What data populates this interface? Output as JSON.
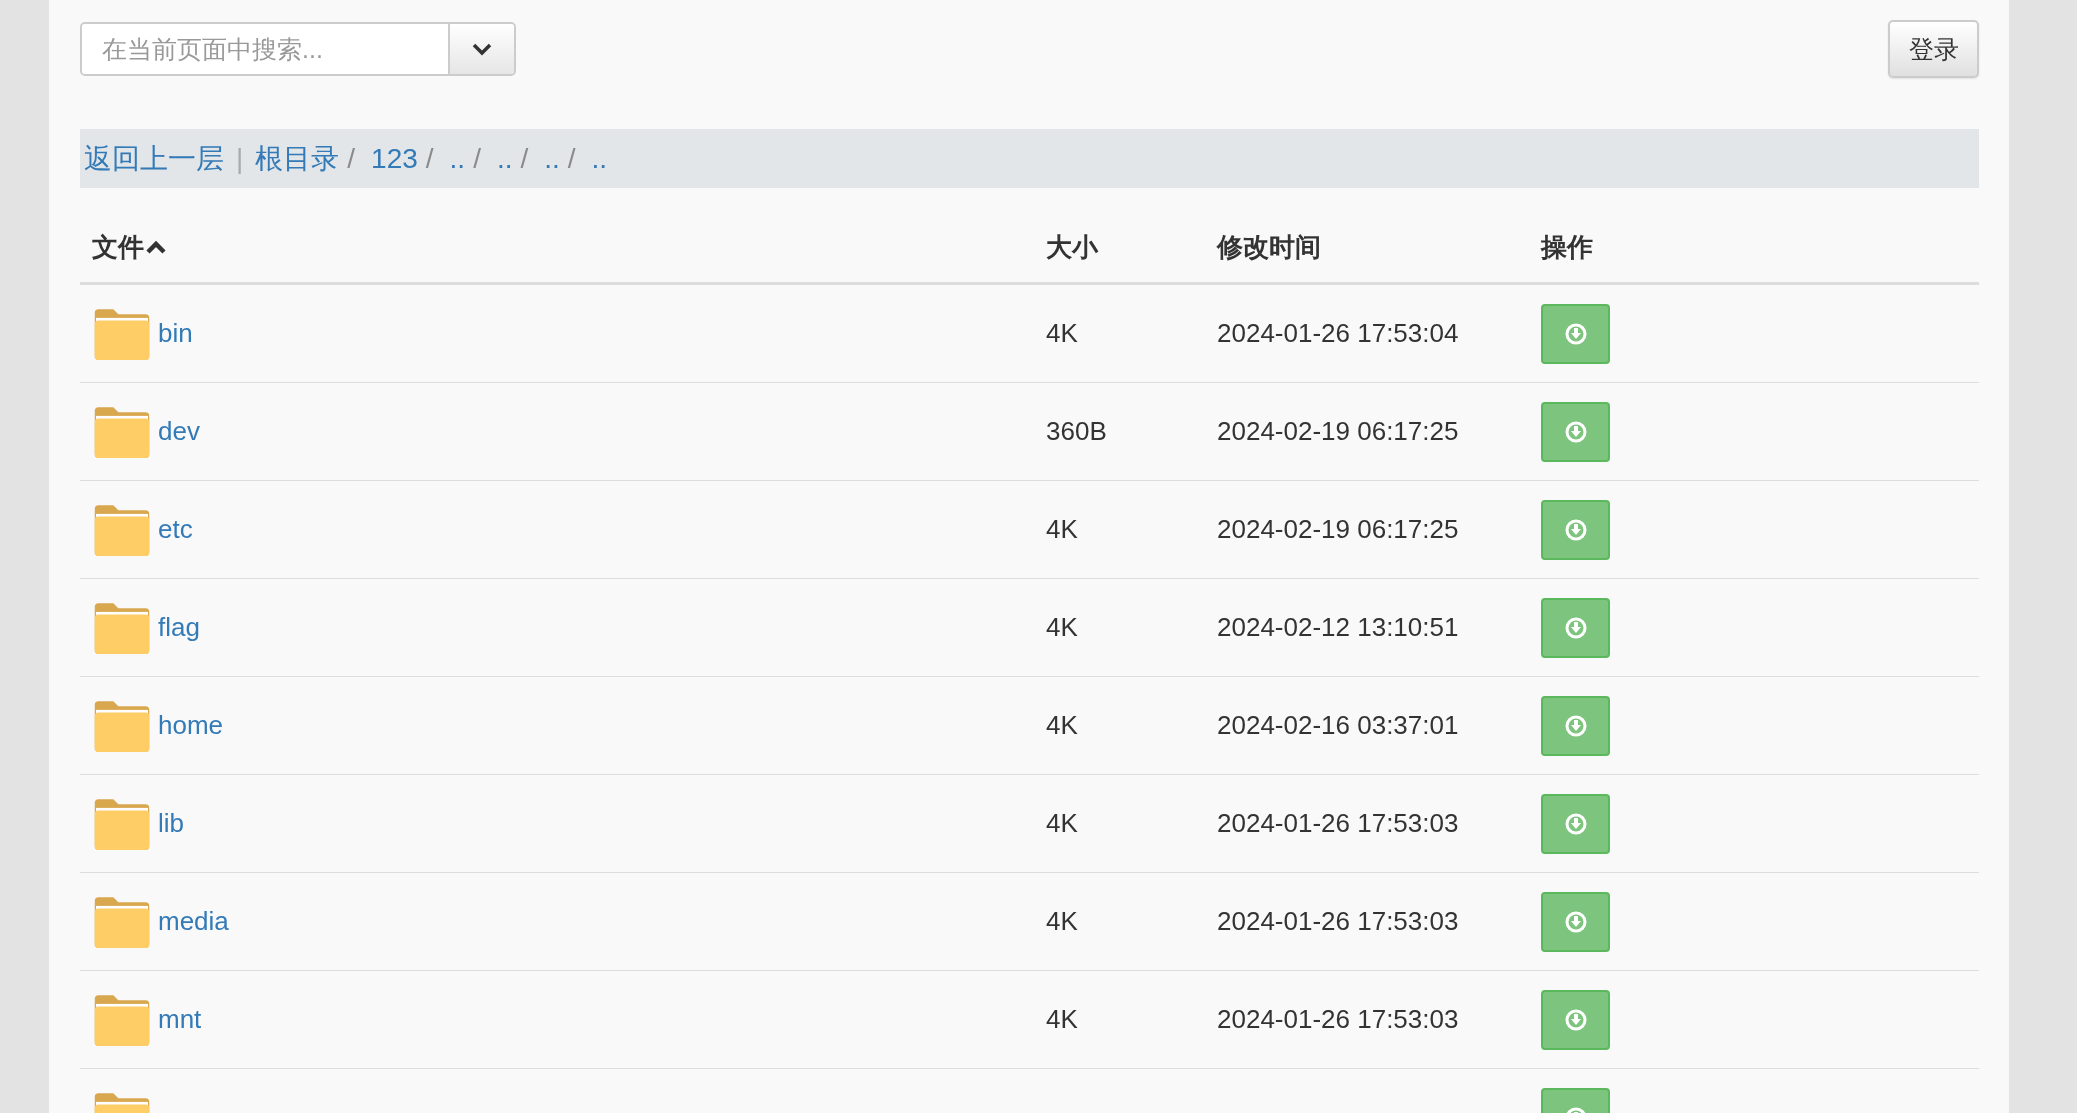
{
  "search": {
    "placeholder": "在当前页面中搜索..."
  },
  "login_button": "登录",
  "breadcrumb": {
    "back": "返回上一层",
    "separator": "|",
    "slash": "/",
    "items": [
      {
        "label": "根目录"
      },
      {
        "label": "123"
      },
      {
        "label": ".."
      },
      {
        "label": ".."
      },
      {
        "label": ".."
      },
      {
        "label": ".."
      }
    ]
  },
  "table": {
    "columns": [
      {
        "label": "文件",
        "sorted": true
      },
      {
        "label": "大小",
        "sorted": false
      },
      {
        "label": "修改时间",
        "sorted": false
      },
      {
        "label": "操作",
        "sorted": false
      }
    ],
    "rows": [
      {
        "kind": "folder",
        "name": "bin",
        "size": "4K",
        "modified": "2024-01-26 17:53:04"
      },
      {
        "kind": "folder",
        "name": "dev",
        "size": "360B",
        "modified": "2024-02-19 06:17:25"
      },
      {
        "kind": "folder",
        "name": "etc",
        "size": "4K",
        "modified": "2024-02-19 06:17:25"
      },
      {
        "kind": "folder",
        "name": "flag",
        "size": "4K",
        "modified": "2024-02-12 13:10:51"
      },
      {
        "kind": "folder",
        "name": "home",
        "size": "4K",
        "modified": "2024-02-16 03:37:01"
      },
      {
        "kind": "folder",
        "name": "lib",
        "size": "4K",
        "modified": "2024-01-26 17:53:03"
      },
      {
        "kind": "folder",
        "name": "media",
        "size": "4K",
        "modified": "2024-01-26 17:53:03"
      },
      {
        "kind": "folder",
        "name": "mnt",
        "size": "4K",
        "modified": "2024-01-26 17:53:03"
      },
      {
        "kind": "folder"
      }
    ]
  }
}
